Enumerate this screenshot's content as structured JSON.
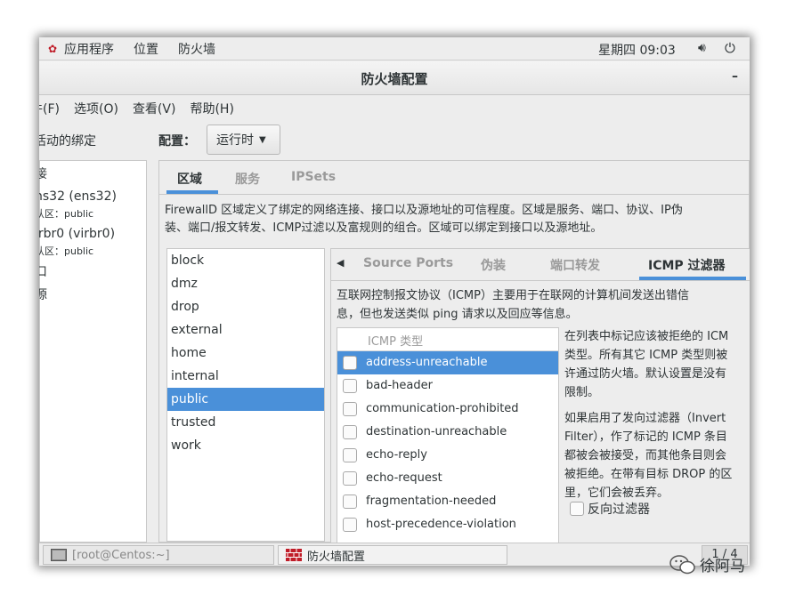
{
  "topbar": {
    "apps": "应用程序",
    "places": "位置",
    "firewall": "防火墙",
    "clock": "星期四 09:03"
  },
  "window": {
    "title": "防火墙配置",
    "minimize": "–"
  },
  "menubar": {
    "file": "件(F)",
    "options": "选项(O)",
    "view": "查看(V)",
    "help": "帮助(H)"
  },
  "left": {
    "header": "活动的绑定",
    "items": [
      {
        "label": "接"
      },
      {
        "label": "ns32 (ens32)",
        "sub": "认区：public"
      },
      {
        "label": "irbr0 (virbr0)",
        "sub": "认区：public"
      },
      {
        "label": "口"
      },
      {
        "label": "源"
      }
    ]
  },
  "config": {
    "label": "配置：",
    "value": "运行时"
  },
  "tabs": [
    "区域",
    "服务",
    "IPSets"
  ],
  "zone_description": [
    "FirewallD 区域定义了绑定的网络连接、接口以及源地址的可信程度。区域是服务、端口、协议、IP伪",
    "装、端口/报文转发、ICMP过滤以及富规则的组合。区域可以绑定到接口以及源地址。"
  ],
  "zones": [
    "block",
    "dmz",
    "drop",
    "external",
    "home",
    "internal",
    "public",
    "trusted",
    "work"
  ],
  "selected_zone": "public",
  "inner_tabs": [
    "Source Ports",
    "伪装",
    "端口转发",
    "ICMP 过滤器"
  ],
  "icmp_description": [
    "互联网控制报文协议（ICMP）主要用于在联网的计算机间发送出错信",
    "息，但也发送类似 ping 请求以及回应等信息。"
  ],
  "icmp_header": "ICMP 类型",
  "icmp_types": [
    "address-unreachable",
    "bad-header",
    "communication-prohibited",
    "destination-unreachable",
    "echo-reply",
    "echo-request",
    "fragmentation-needed",
    "host-precedence-violation"
  ],
  "icmp_help": [
    "在列表中标记应该被拒绝的 ICM",
    "类型。所有其它 ICMP 类型则被",
    "许通过防火墙。默认设置是没有",
    "限制。",
    "如果启用了发向过滤器（Invert",
    "Filter），作了标记的 ICMP 条目",
    "都被会被接受，而其他条目则会",
    "被拒绝。在带有目标 DROP 的区",
    "里，它们会被丢弃。"
  ],
  "invert_filter": "反向过滤器",
  "taskbar": {
    "terminal": "[root@Centos:~]",
    "firewall": "防火墙配置",
    "pager": "1 / 4"
  },
  "watermark": "徐阿马"
}
